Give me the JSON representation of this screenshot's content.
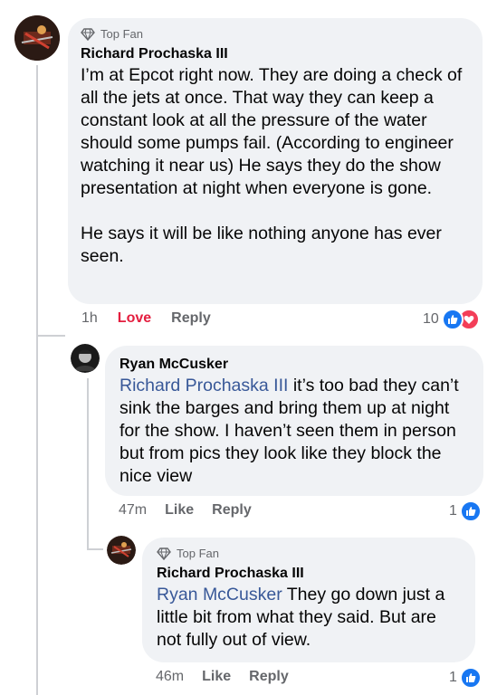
{
  "comments": [
    {
      "badge": "Top Fan",
      "author": "Richard Prochaska III",
      "text": "I’m at Epcot right now. They are doing a check of all the jets at once. That way they can keep a constant look at all the pressure of the water should some pumps fail. (According to engineer watching it near us) He says they do the show presentation at night when everyone is gone.\n\nHe says it will be like nothing anyone has ever seen.",
      "time": "1h",
      "reaction_label": "Love",
      "reply_label": "Reply",
      "reaction_count": "10"
    },
    {
      "author": "Ryan McCusker",
      "mention": "Richard Prochaska III",
      "text": " it’s too bad they can’t sink the barges and bring them up at night for the show. I haven’t seen them in person but from pics they look like they block the nice view",
      "time": "47m",
      "reaction_label": "Like",
      "reply_label": "Reply",
      "reaction_count": "1"
    },
    {
      "badge": "Top Fan",
      "author": "Richard Prochaska III",
      "mention": "Ryan McCusker",
      "text": " They go down just a little bit from what they said. But are not fully out of view.",
      "time": "46m",
      "reaction_label": "Like",
      "reply_label": "Reply",
      "reaction_count": "1"
    }
  ],
  "colors": {
    "love": "#e41e3f",
    "like": "#1877f2",
    "bubble": "#f0f2f5",
    "mention": "#385898"
  }
}
